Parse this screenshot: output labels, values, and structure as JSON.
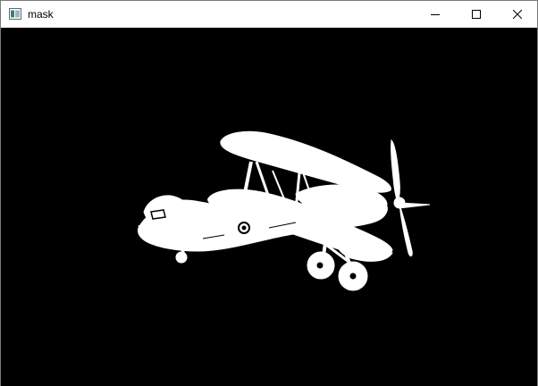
{
  "window": {
    "title": "mask"
  },
  "titlebar": {
    "icons": [
      "app-icon",
      "minimize-icon",
      "maximize-icon",
      "close-icon"
    ]
  },
  "canvas": {
    "background": "#000000",
    "mask_color": "#ffffff",
    "content": "biplane-silhouette"
  }
}
